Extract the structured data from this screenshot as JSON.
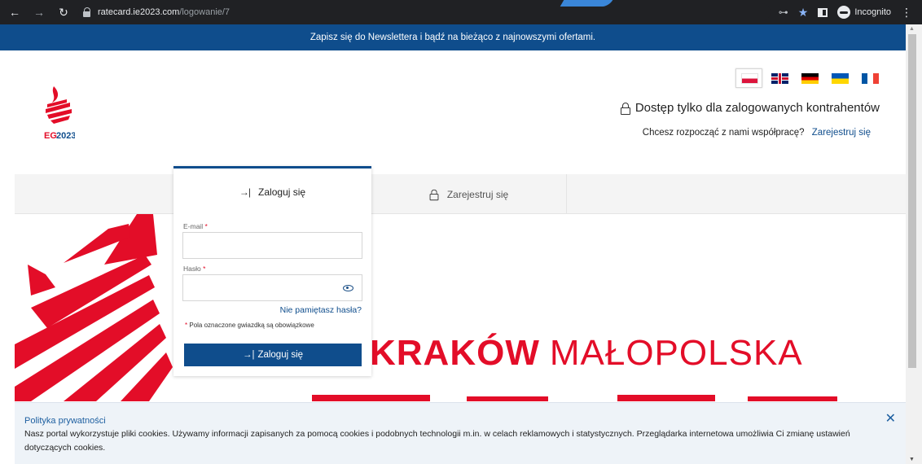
{
  "browser": {
    "url_host": "ratecard.ie2023.com",
    "url_path": "/logowanie/7",
    "profile_label": "Incognito"
  },
  "newsletter": {
    "text": "Zapisz się do Newslettera i bądź na bieżąco z najnowszymi ofertami."
  },
  "header": {
    "languages": [
      "pl",
      "en",
      "de",
      "ua",
      "fr"
    ],
    "active_language": "pl",
    "access_text": "Dostęp tylko dla zalogowanych kontrahentów",
    "coop_question": "Chcesz rozpocząć z nami współpracę?",
    "register_link": "Zarejestruj się"
  },
  "tabs": {
    "login_label": "Zaloguj się",
    "register_label": "Zarejestruj się"
  },
  "login_form": {
    "email_label": "E-mail",
    "email_value": "",
    "password_label": "Hasło",
    "password_value": "",
    "required_mark": "*",
    "forgot_label": "Nie pamiętasz hasła?",
    "required_note": "Pola oznaczone gwiazdką są obowiązkowe",
    "submit_label": "Zaloguj się"
  },
  "hero": {
    "text_bold": "KRAKÓW",
    "text_regular": "MAŁOPOLSKA"
  },
  "cookie": {
    "title": "Polityka prywatności",
    "text": "Nasz portal wykorzystuje pliki cookies. Używamy informacji zapisanych za pomocą cookies i podobnych technologii m.in. w celach reklamowych i statystycznych. Przeglądarka internetowa umożliwia Ci zmianę ustawień dotyczących cookies."
  },
  "colors": {
    "brand_blue": "#0f4d8c",
    "brand_red": "#e30d28",
    "chrome_bg": "#202124"
  }
}
